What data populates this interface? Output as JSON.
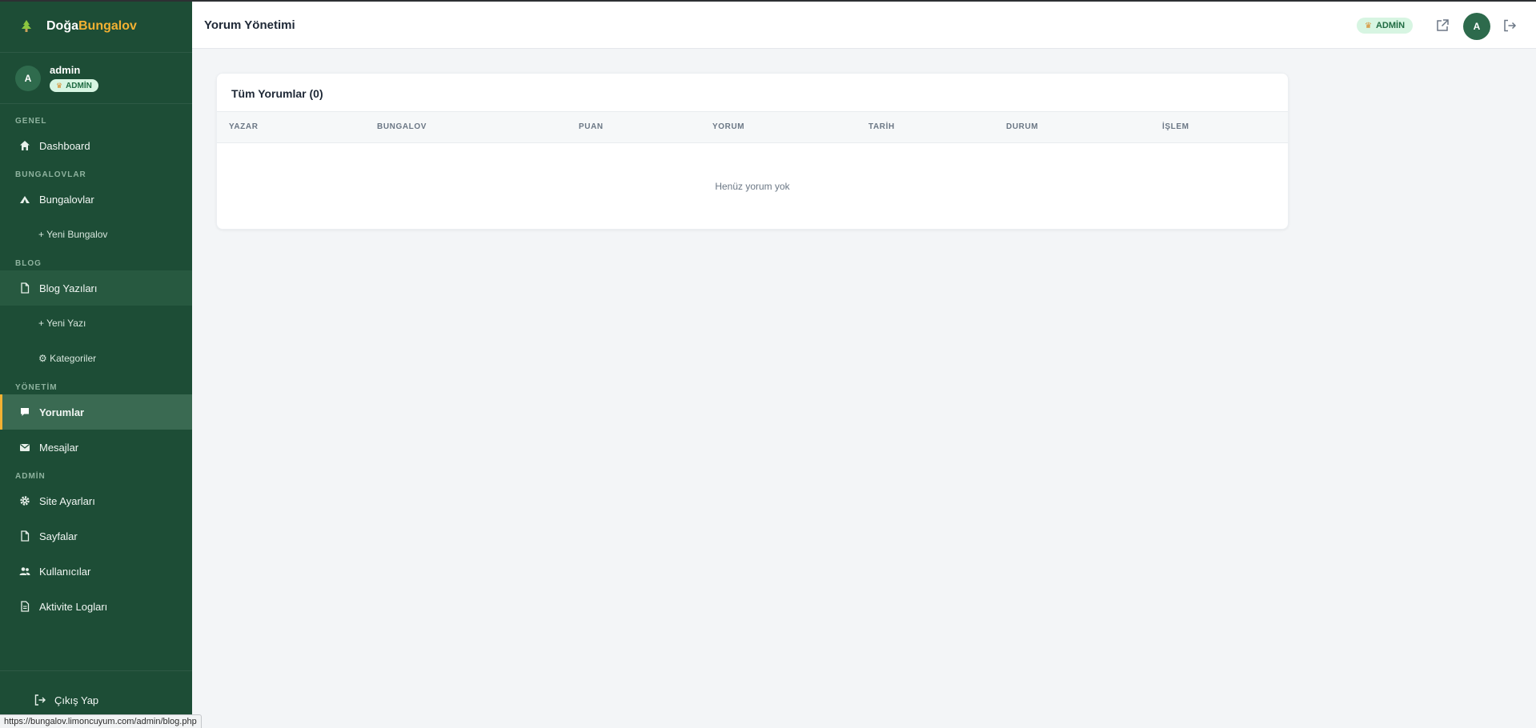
{
  "brand": {
    "part1": "Doğa",
    "part2": "Bungalov"
  },
  "user": {
    "initial": "A",
    "name": "admin",
    "role": "ADMİN"
  },
  "sections": {
    "genel": "GENEL",
    "bungalovlar": "BUNGALOVLAR",
    "blog": "BLOG",
    "yonetim": "YÖNETİM",
    "admin": "ADMİN"
  },
  "nav": {
    "dashboard": "Dashboard",
    "bungalovlar": "Bungalovlar",
    "yeni_bungalov": "+ Yeni Bungalov",
    "blog_yazilari": "Blog Yazıları",
    "yeni_yazi": "+ Yeni Yazı",
    "kategoriler": "⚙ Kategoriler",
    "yorumlar": "Yorumlar",
    "mesajlar": "Mesajlar",
    "site_ayarlari": "Site Ayarları",
    "sayfalar": "Sayfalar",
    "kullanicilar": "Kullanıcılar",
    "aktivite_loglari": "Aktivite Logları",
    "cikis": "Çıkış Yap"
  },
  "header": {
    "title": "Yorum Yönetimi",
    "badge": "ADMİN",
    "avatar": "A"
  },
  "card": {
    "title": "Tüm Yorumlar (0)",
    "columns": [
      "YAZAR",
      "BUNGALOV",
      "PUAN",
      "YORUM",
      "TARİH",
      "DURUM",
      "İŞLEM"
    ],
    "empty_text": "Henüz yorum yok"
  },
  "status_url": "https://bungalov.limoncuyum.com/admin/blog.php",
  "colors": {
    "sidebar": "#1d4d36",
    "accent": "#f3b132",
    "badge_bg": "#d7f5e2",
    "avatar": "#2d6a4c"
  }
}
